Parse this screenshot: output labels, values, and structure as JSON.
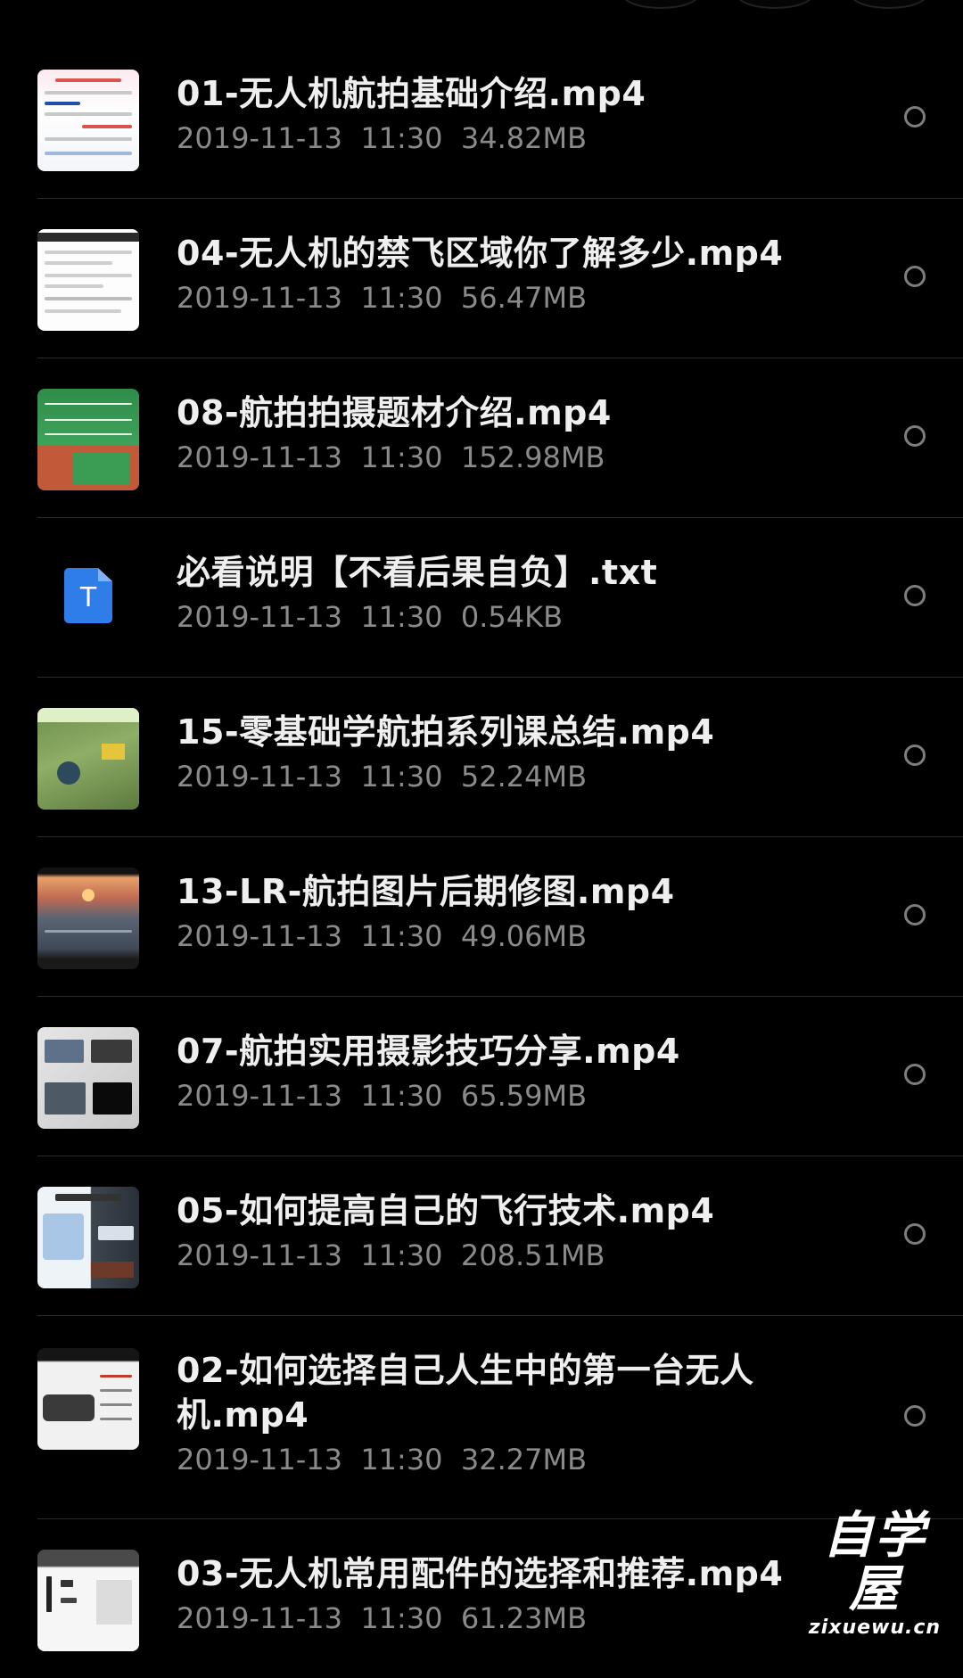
{
  "files": [
    {
      "name": "01-无人机航拍基础介绍.mp4",
      "meta": "2019-11-13  11:30  34.82MB",
      "thumb": "doc-thumb"
    },
    {
      "name": "04-无人机的禁飞区域你了解多少.mp4",
      "meta": "2019-11-13  11:30  56.47MB",
      "thumb": "screen-thumb"
    },
    {
      "name": "08-航拍拍摄题材介绍.mp4",
      "meta": "2019-11-13  11:30  152.98MB",
      "thumb": "field-thumb"
    },
    {
      "name": "必看说明【不看后果自负】.txt",
      "meta": "2019-11-13  11:30  0.54KB",
      "thumb": "txt-icon",
      "icon_letter": "T"
    },
    {
      "name": "15-零基础学航拍系列课总结.mp4",
      "meta": "2019-11-13  11:30  52.24MB",
      "thumb": "aerial-thumb"
    },
    {
      "name": "13-LR-航拍图片后期修图.mp4",
      "meta": "2019-11-13  11:30  49.06MB",
      "thumb": "sunset-thumb"
    },
    {
      "name": "07-航拍实用摄影技巧分享.mp4",
      "meta": "2019-11-13  11:30  65.59MB",
      "thumb": "collage-thumb"
    },
    {
      "name": "05-如何提高自己的飞行技术.mp4",
      "meta": "2019-11-13  11:30  208.51MB",
      "thumb": "license-thumb"
    },
    {
      "name": "02-如何选择自己人生中的第一台无人机.mp4",
      "meta": "2019-11-13  11:30  32.27MB",
      "thumb": "drone-thumb"
    },
    {
      "name": "03-无人机常用配件的选择和推荐.mp4",
      "meta": "2019-11-13  11:30  61.23MB",
      "thumb": "gear-thumb"
    }
  ],
  "watermark": {
    "main": "自学屋",
    "sub": "zixuewu.cn"
  },
  "colors": {
    "background": "#000000",
    "title": "#efefef",
    "meta": "#8a8a8a",
    "txt_icon": "#2f7de9"
  }
}
